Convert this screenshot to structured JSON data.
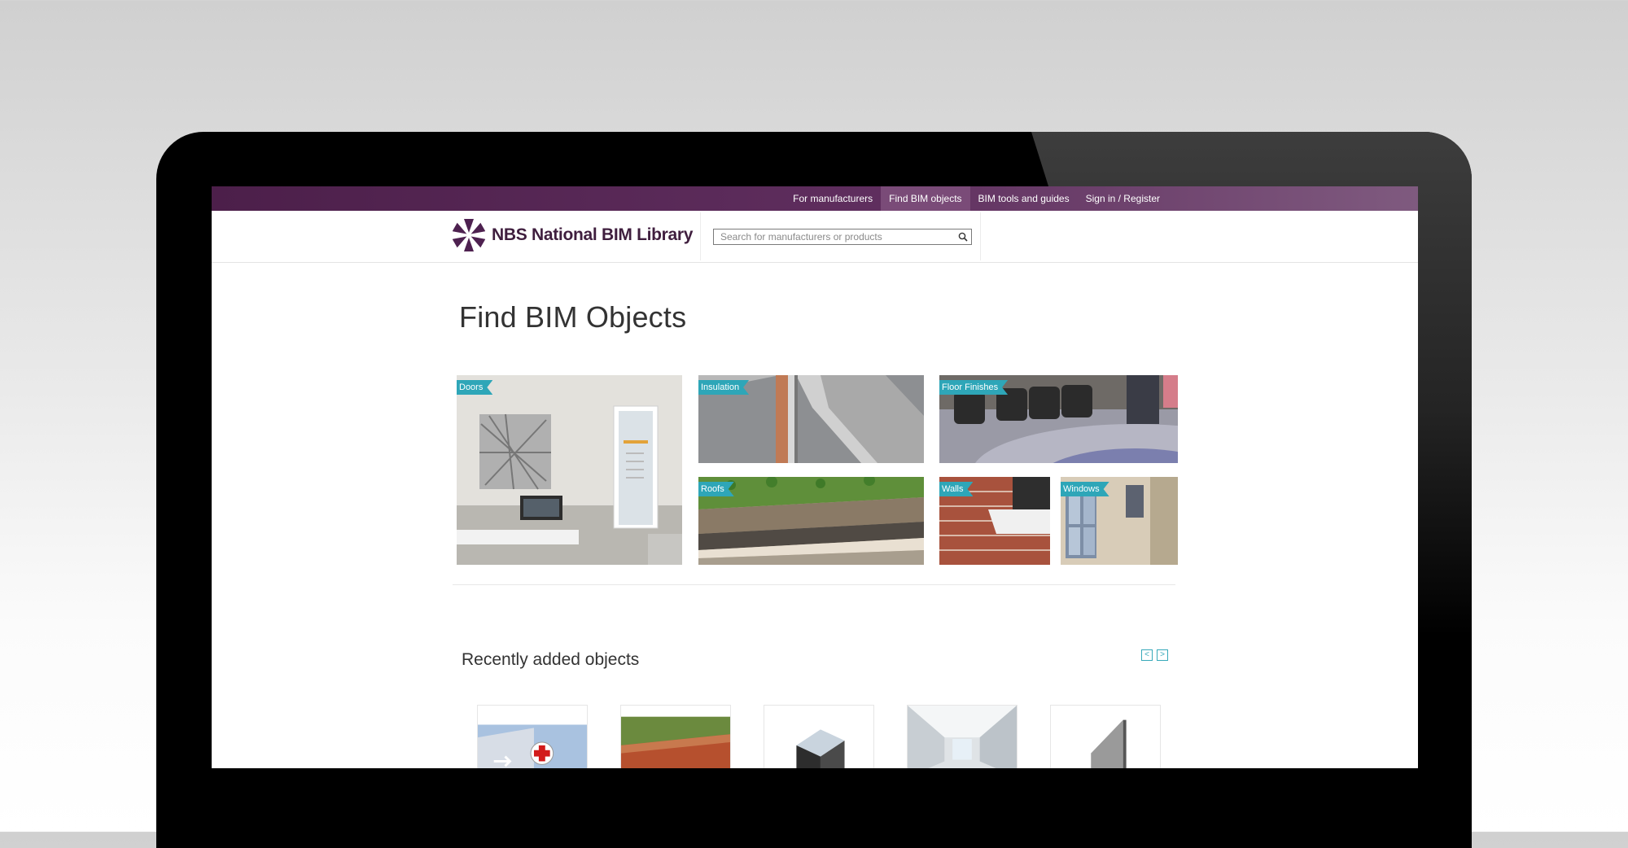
{
  "topnav": {
    "items": [
      {
        "label": "For manufacturers"
      },
      {
        "label": "Find BIM objects"
      },
      {
        "label": "BIM tools and guides"
      },
      {
        "label": "Sign in / Register"
      }
    ]
  },
  "header": {
    "logo_text": "NBS National BIM Library",
    "search_placeholder": "Search for manufacturers or products"
  },
  "main": {
    "title": "Find BIM Objects",
    "categories": [
      {
        "label": "Doors"
      },
      {
        "label": "Insulation"
      },
      {
        "label": "Floor Finishes"
      },
      {
        "label": "Roofs"
      },
      {
        "label": "Walls"
      },
      {
        "label": "Windows"
      }
    ],
    "recent": {
      "title": "Recently added objects",
      "prev_label": "<",
      "next_label": ">"
    }
  },
  "colors": {
    "brand_purple": "#4c1f4a",
    "accent_teal": "#2ea6b8"
  }
}
